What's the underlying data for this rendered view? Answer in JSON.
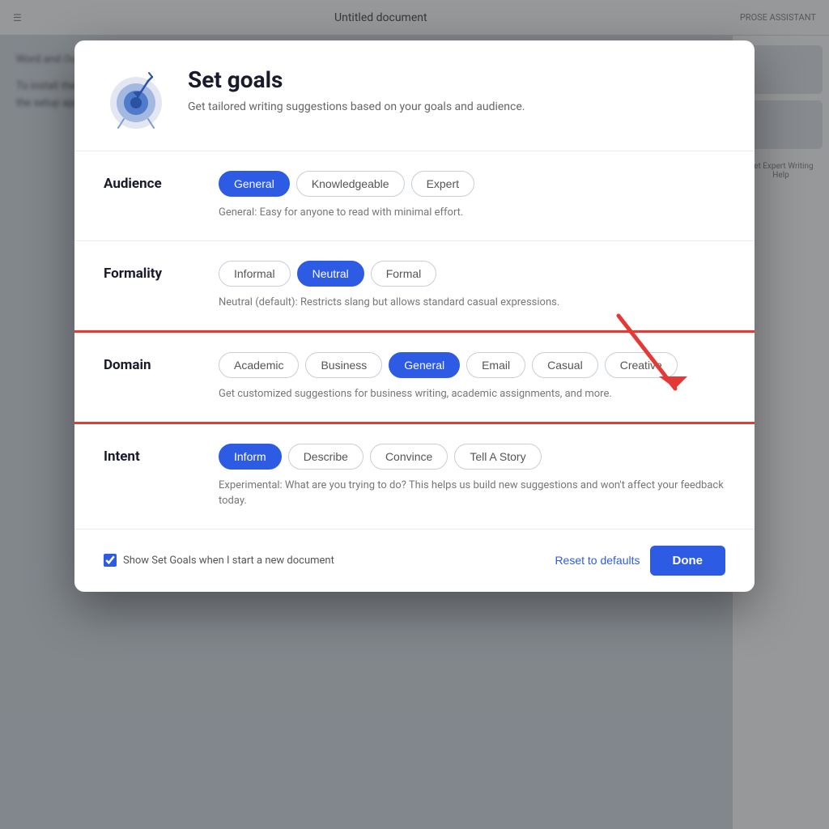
{
  "bg": {
    "topbar_title": "Untitled document",
    "topbar_right": "PROSE ASSISTANT"
  },
  "modal": {
    "title": "Set goals",
    "subtitle": "Get tailored writing suggestions based on your goals and audience.",
    "icon_label": "target-icon"
  },
  "audience": {
    "label": "Audience",
    "options": [
      "General",
      "Knowledgeable",
      "Expert"
    ],
    "active": "General",
    "description": "General: Easy for anyone to read with minimal effort."
  },
  "formality": {
    "label": "Formality",
    "options": [
      "Informal",
      "Neutral",
      "Formal"
    ],
    "active": "Neutral",
    "description": "Neutral (default): Restricts slang but allows standard casual expressions."
  },
  "domain": {
    "label": "Domain",
    "options": [
      "Academic",
      "Business",
      "General",
      "Email",
      "Casual",
      "Creative"
    ],
    "active": "General",
    "description": "Get customized suggestions for business writing, academic assignments, and more."
  },
  "intent": {
    "label": "Intent",
    "options": [
      "Inform",
      "Describe",
      "Convince",
      "Tell A Story"
    ],
    "active": "Inform",
    "description": "Experimental: What are you trying to do? This helps us build new suggestions and won't affect your feedback today."
  },
  "footer": {
    "checkbox_label": "Show Set Goals when I start a new document",
    "reset_label": "Reset to defaults",
    "done_label": "Done"
  },
  "colors": {
    "active_btn": "#2d5be3",
    "highlight_border": "#e53935"
  }
}
